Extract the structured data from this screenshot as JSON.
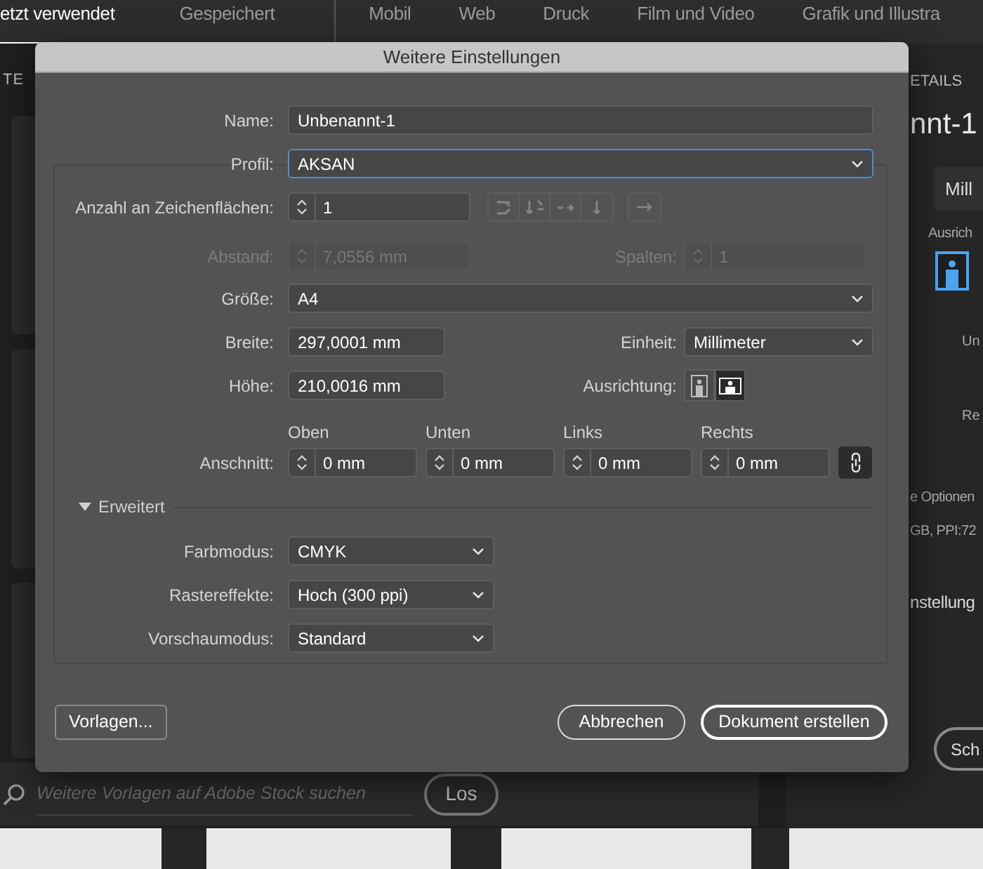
{
  "app_tabs": [
    {
      "label": "etzt verwendet",
      "selected": true
    },
    {
      "label": "Gespeichert",
      "selected": false
    },
    {
      "label": "Mobil",
      "selected": false
    },
    {
      "label": "Web",
      "selected": false
    },
    {
      "label": "Druck",
      "selected": false
    },
    {
      "label": "Film und Video",
      "selected": false
    },
    {
      "label": "Grafik und Illustra",
      "selected": false
    }
  ],
  "left_panel": {
    "heading": "TE"
  },
  "stock_search": {
    "placeholder": "Weitere Vorlagen auf Adobe Stock suchen",
    "button": "Los"
  },
  "details_panel": {
    "heading": "ETAILS",
    "document_name": "nnt-1",
    "unit": "Mill",
    "orientation_label": "Ausrich",
    "label_1": "Un",
    "label_2": "Re",
    "text_1": "e Optionen",
    "text_2": "GB, PPI:72",
    "text_3": "nstellung",
    "button": "Sch"
  },
  "dialog": {
    "title": "Weitere Einstellungen",
    "name": {
      "label": "Name:",
      "value": "Unbenannt-1"
    },
    "profile": {
      "label": "Profil:",
      "value": "AKSAN",
      "focused": true
    },
    "artboards": {
      "label": "Anzahl an Zeichenflächen:",
      "value": "1",
      "disabled": false
    },
    "spacing": {
      "label": "Abstand:",
      "value": "7,0556 mm",
      "disabled": true
    },
    "columns": {
      "label": "Spalten:",
      "value": "1",
      "disabled": true
    },
    "size": {
      "label": "Größe:",
      "value": "A4"
    },
    "width": {
      "label": "Breite:",
      "value": "297,0001 mm"
    },
    "unit": {
      "label": "Einheit:",
      "value": "Millimeter"
    },
    "height": {
      "label": "Höhe:",
      "value": "210,0016 mm"
    },
    "orientation": {
      "label": "Ausrichtung:",
      "options": [
        {
          "kind": "portrait",
          "selected": false
        },
        {
          "kind": "landscape",
          "selected": true
        }
      ]
    },
    "bleed": {
      "label": "Anschnitt:",
      "linked": true,
      "fields": [
        {
          "heading": "Oben",
          "value": "0 mm"
        },
        {
          "heading": "Unten",
          "value": "0 mm"
        },
        {
          "heading": "Links",
          "value": "0 mm"
        },
        {
          "heading": "Rechts",
          "value": "0 mm"
        }
      ]
    },
    "advanced": {
      "label": "Erweitert",
      "expanded": true,
      "fields": [
        {
          "label": "Farbmodus:",
          "value": "CMYK"
        },
        {
          "label": "Rastereffekte:",
          "value": "Hoch (300 ppi)"
        },
        {
          "label": "Vorschaumodus:",
          "value": "Standard"
        }
      ]
    },
    "buttons": {
      "templates": "Vorlagen...",
      "cancel": "Abbrechen",
      "create": "Dokument erstellen"
    }
  }
}
